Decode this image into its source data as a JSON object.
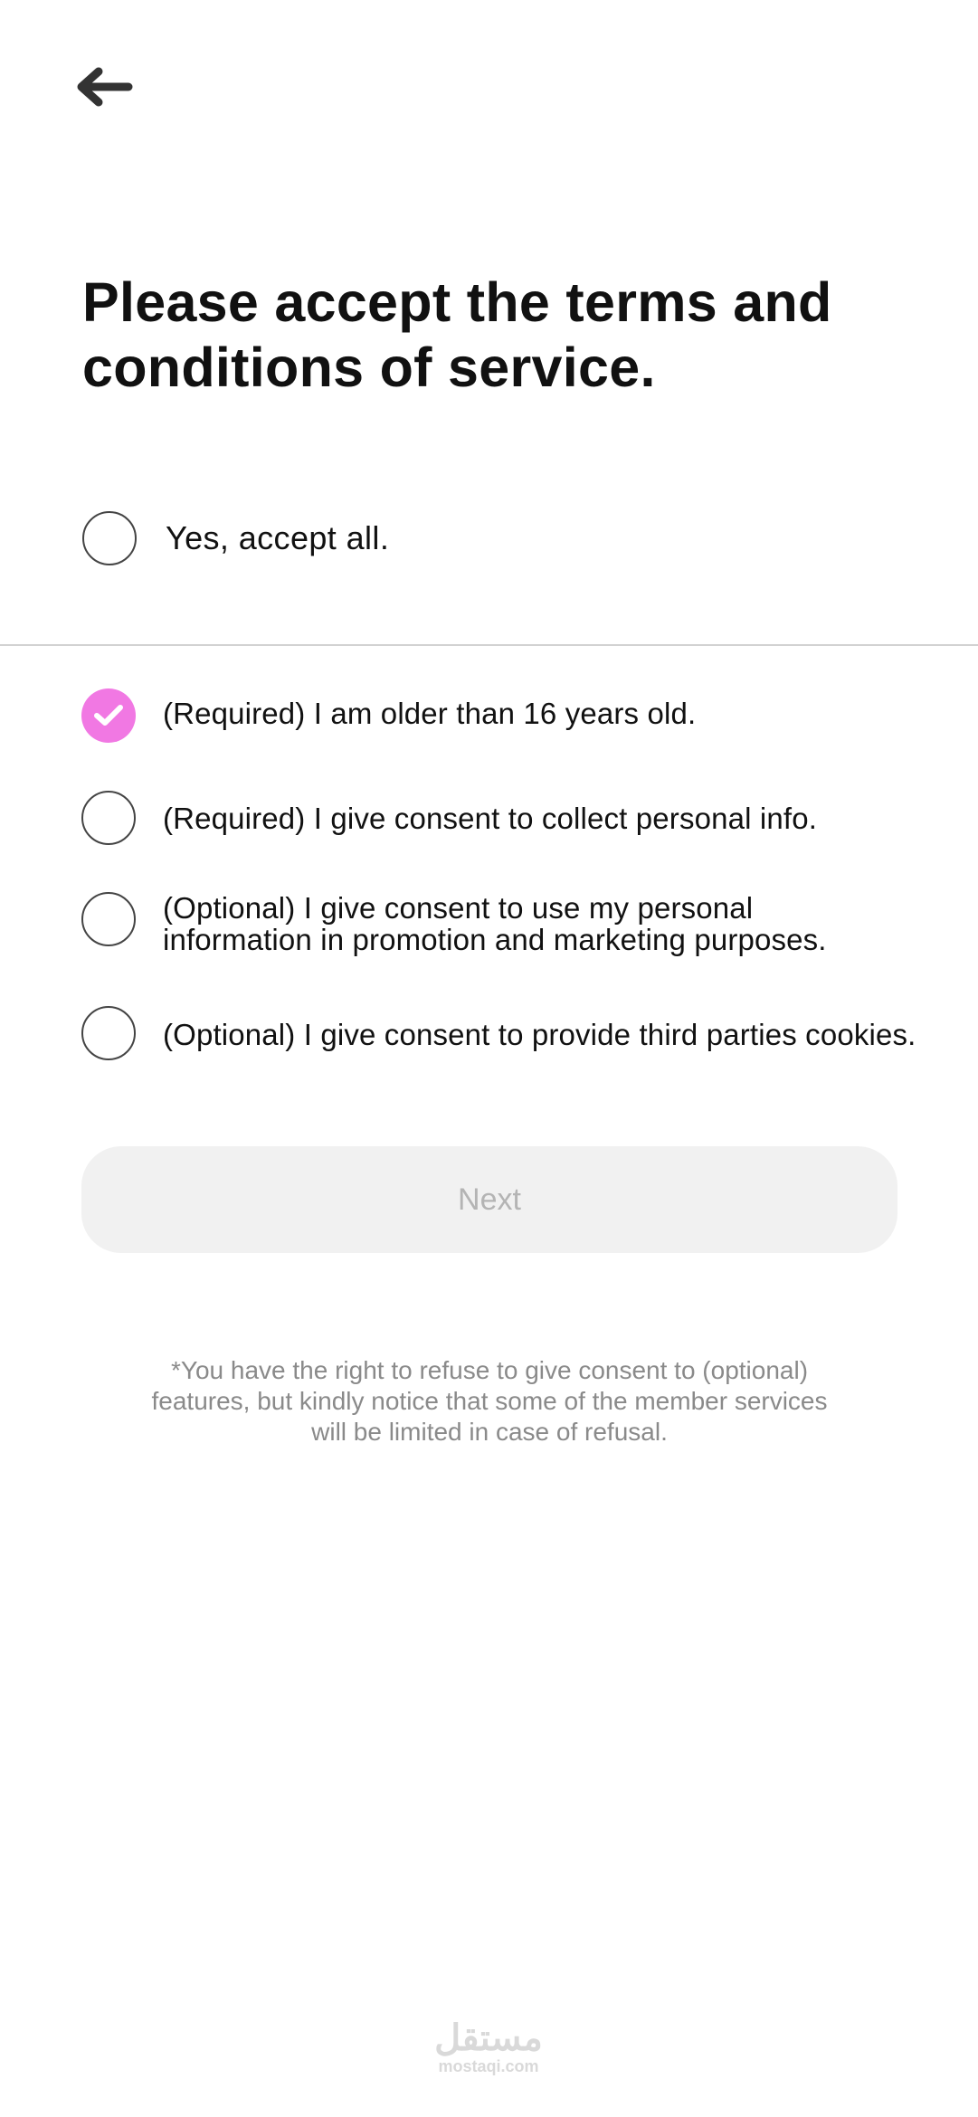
{
  "header": {
    "back_icon": "arrow-left-icon"
  },
  "title": "Please accept the terms and conditions of service.",
  "accept_all": {
    "label": "Yes, accept all.",
    "checked": false
  },
  "consents": [
    {
      "label": "(Required) I am older than 16 years old.",
      "checked": true
    },
    {
      "label": "(Required) I give consent to collect personal info.",
      "checked": false
    },
    {
      "label_line1": "(Optional) I give consent to use my personal",
      "label_line2": "information in promotion and marketing purposes.",
      "checked": false
    },
    {
      "label": "(Optional) I give consent to provide third parties cookies.",
      "checked": false
    }
  ],
  "next_button": {
    "label": "Next",
    "enabled": false
  },
  "footnote": {
    "line1": "*You have the right to refuse to give consent to (optional)",
    "line2": "features, but kindly notice that some of the member services",
    "line3": "will be limited in case of refusal."
  },
  "watermark": {
    "logo": "مستقل",
    "url": "mostaqi.com"
  },
  "colors": {
    "accent": "#f178e3",
    "button_disabled_bg": "#f1f1f1",
    "button_disabled_text": "#b4b4b4",
    "muted_text": "#8a8a8a"
  }
}
